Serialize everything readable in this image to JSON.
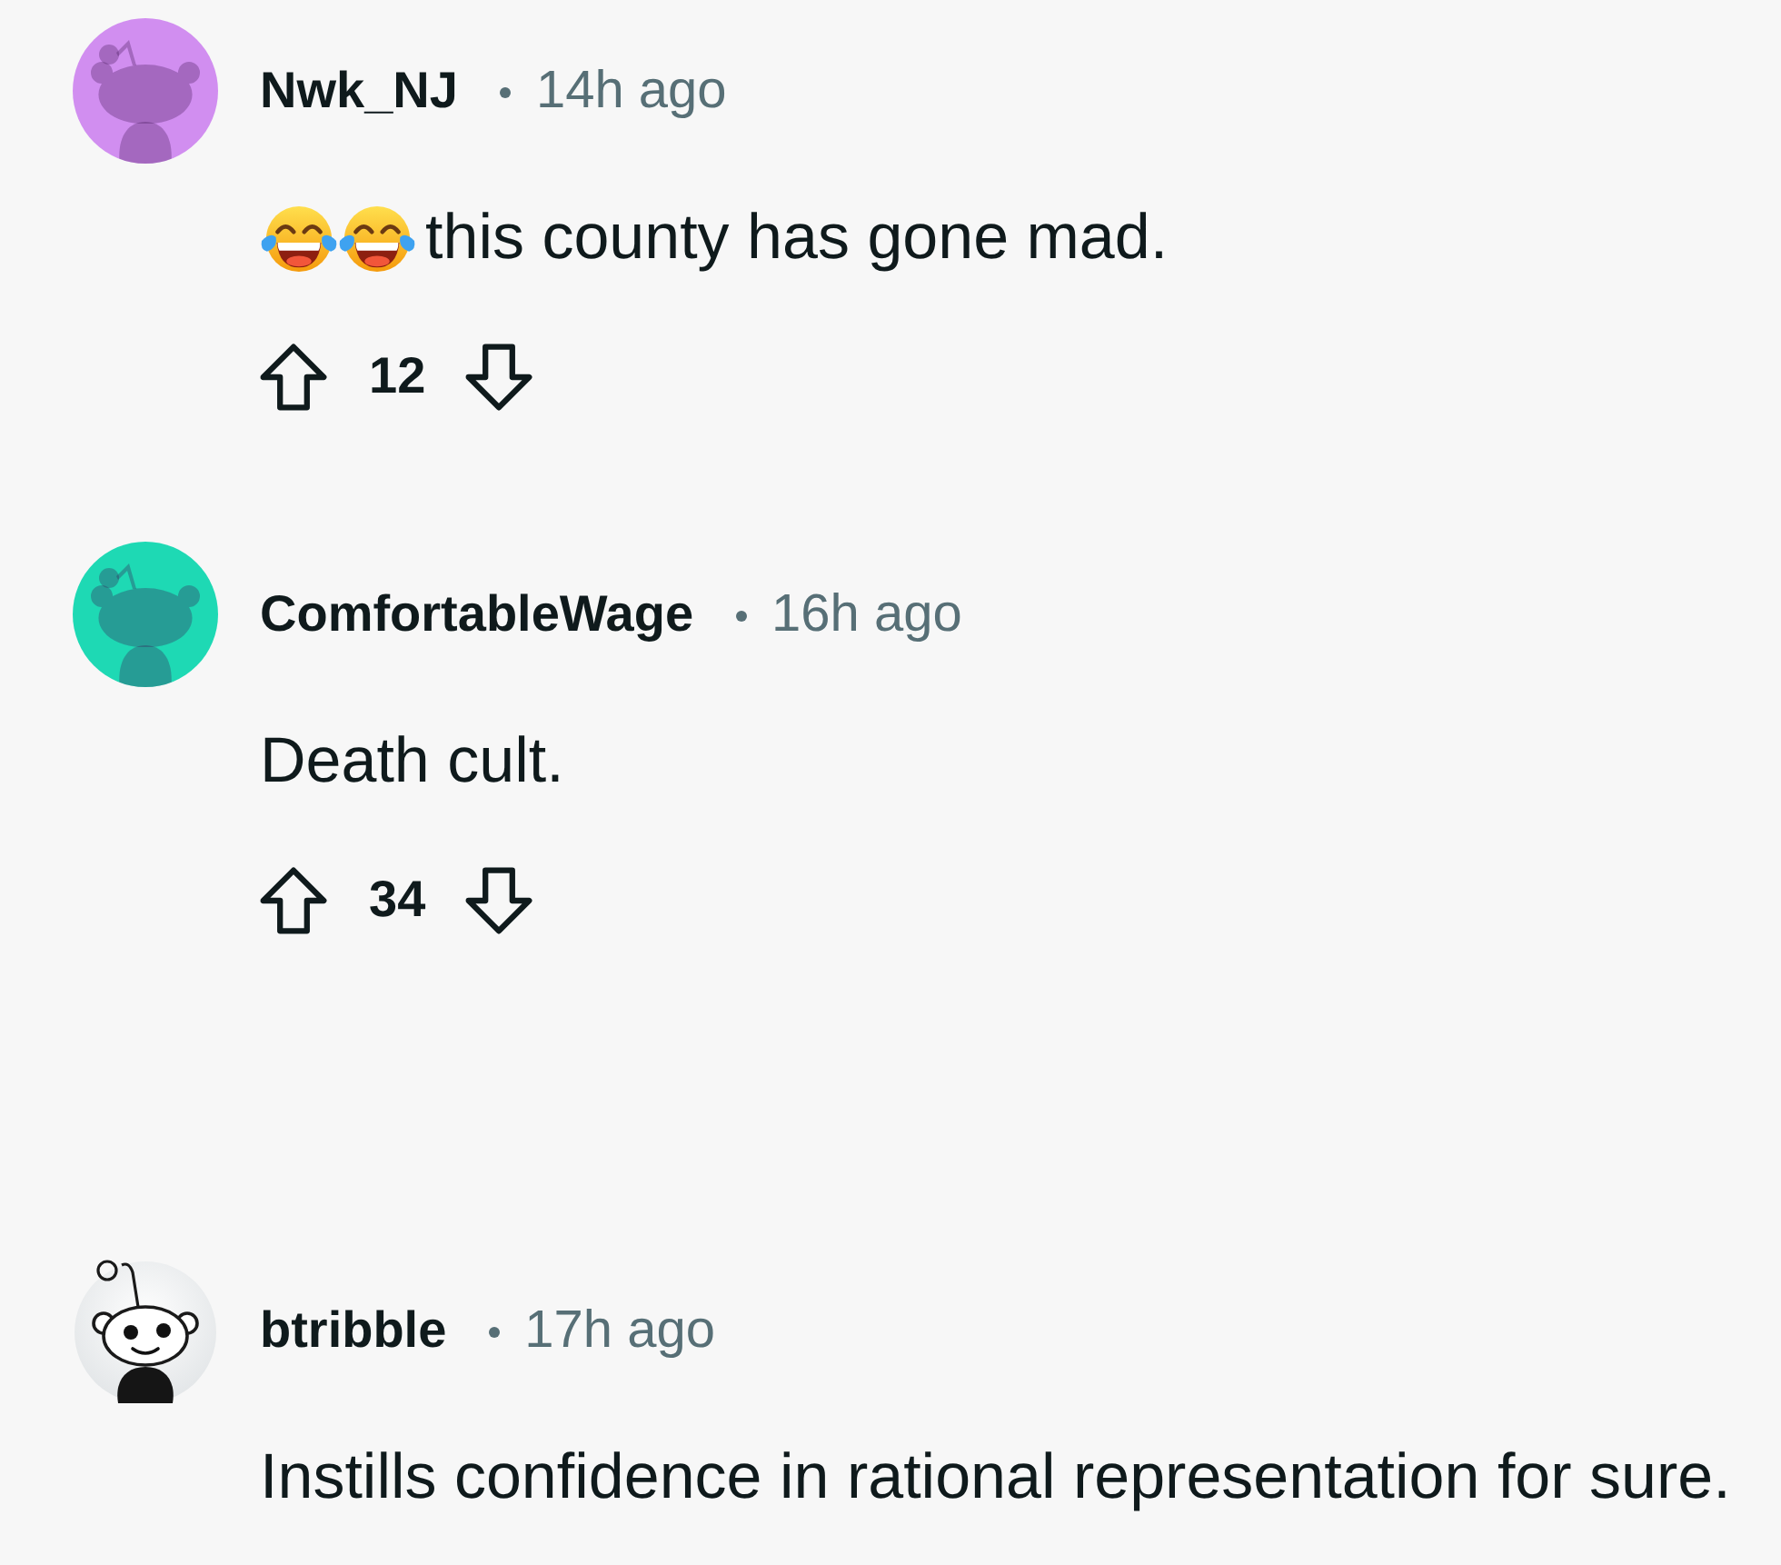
{
  "comments": [
    {
      "author": "Nwk_NJ",
      "time": "14h ago",
      "avatar": {
        "kind": "default",
        "color": "#d18ef0"
      },
      "body": [
        {
          "kind": "emoji"
        },
        {
          "kind": "emoji"
        },
        {
          "kind": "text",
          "text": "this county has gone mad."
        }
      ],
      "score": "12"
    },
    {
      "author": "ComfortableWage",
      "time": "16h ago",
      "avatar": {
        "kind": "default",
        "color": "#1ed9b4"
      },
      "body": [
        {
          "kind": "text",
          "text": "Death cult."
        }
      ],
      "score": "34"
    },
    {
      "author": "btribble",
      "time": "17h ago",
      "avatar": {
        "kind": "custom"
      },
      "body": [
        {
          "kind": "text",
          "text": "Instills confidence in rational representation for sure."
        }
      ]
    }
  ]
}
